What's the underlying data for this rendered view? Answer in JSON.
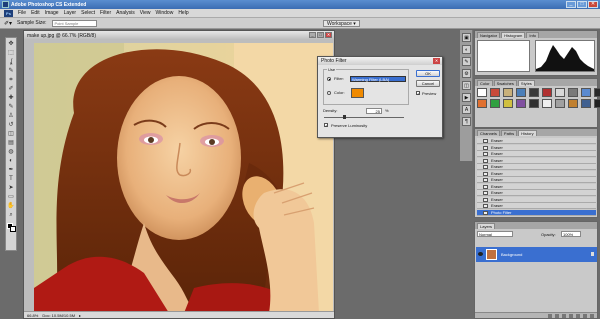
{
  "app": {
    "title": "Adobe Photoshop CS Extended"
  },
  "window_buttons": {
    "minimize": "_",
    "maximize": "□",
    "close": "✕"
  },
  "menu": {
    "items": [
      "File",
      "Edit",
      "Image",
      "Layer",
      "Select",
      "Filter",
      "Analysis",
      "View",
      "Window",
      "Help"
    ],
    "logo": "Ps"
  },
  "options_bar": {
    "sample_size_label": "Sample Size:",
    "sample_size_value": "Point Sample",
    "workspace_label": "Workspace ▾"
  },
  "tools": {
    "icons": [
      "move-icon",
      "marquee-icon",
      "lasso-icon",
      "quick-select-icon",
      "crop-icon",
      "eyedropper-icon",
      "healing-icon",
      "brush-icon",
      "stamp-icon",
      "history-brush-icon",
      "eraser-icon",
      "gradient-icon",
      "blur-icon",
      "dodge-icon",
      "pen-icon",
      "type-icon",
      "path-select-icon",
      "shape-icon",
      "hand-icon",
      "zoom-icon"
    ],
    "glyphs": [
      "✥",
      "⬚",
      "ʆ",
      "✎",
      "⌗",
      "✐",
      "✚",
      "✎",
      "♙",
      "↺",
      "◫",
      "▤",
      "◍",
      "◐",
      "✒",
      "T",
      "➤",
      "▭",
      "✋",
      "⌕"
    ]
  },
  "document": {
    "title": "make up.jpg @ 66.7% (RGB/8)",
    "zoom": "66.8%",
    "doc_size": "Doc: 10.5M/10.5M"
  },
  "photo_filter_dialog": {
    "title": "Photo Filter",
    "group_label": "Use",
    "filter_label": "Filter:",
    "filter_value": "Warming Filter (LBA)",
    "color_label": "Color:",
    "color_value": "#f08a00",
    "density_label": "Density:",
    "density_value": "25",
    "density_unit": "%",
    "density_fraction": 0.25,
    "preserve_luminosity_label": "Preserve Luminosity",
    "preserve_luminosity_checked": true,
    "preview_label": "Preview",
    "preview_checked": true,
    "ok_label": "OK",
    "cancel_label": "Cancel"
  },
  "navigator_panel": {
    "tabs": [
      "Navigator",
      "Histogram",
      "Info"
    ],
    "active_tab": "Histogram"
  },
  "styles_panel": {
    "tabs": [
      "Color",
      "Swatches",
      "Styles"
    ],
    "active_tab": "Styles",
    "style_colors": [
      "#ffffff",
      "#c94a3a",
      "#c8b07a",
      "#4b7fb8",
      "#3a3a3a",
      "#b03030",
      "#d8d8d8",
      "#7a7a7a",
      "#5a8ad0",
      "#2a2a2a",
      "#e07030",
      "#30a040",
      "#d0c040",
      "#8050a0",
      "#303030",
      "#f0f0f0",
      "#a0a0a0",
      "#c08030",
      "#406090",
      "#202020"
    ]
  },
  "history_panel": {
    "tabs": [
      "Channels",
      "Paths",
      "History"
    ],
    "active_tab": "History",
    "items": [
      "Eraser",
      "Eraser",
      "Eraser",
      "Eraser",
      "Eraser",
      "Eraser",
      "Eraser",
      "Eraser",
      "Eraser",
      "Eraser",
      "Eraser",
      "Photo Filter"
    ],
    "selected_label": "Photo Filter"
  },
  "layers_panel": {
    "tabs": [
      "Layers"
    ],
    "blend_mode": "Normal",
    "opacity_label": "Opacity:",
    "opacity_value": "100%",
    "lock_label": "Lock:",
    "fill_label": "Fill:",
    "fill_value": "100%",
    "layer_name": "Background"
  },
  "colors": {
    "accent": "#3a6fd0",
    "titlebar": "#3b6db3",
    "panel": "#c9c9c9"
  }
}
